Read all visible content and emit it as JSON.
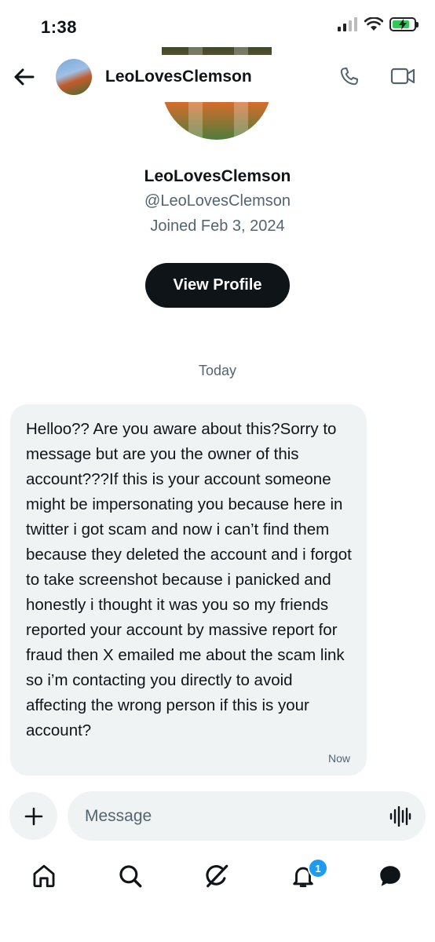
{
  "status_bar": {
    "time": "1:38",
    "battery_level": 0.8
  },
  "header": {
    "name": "LeoLovesClemson"
  },
  "profile": {
    "name": "LeoLovesClemson",
    "handle": "@LeoLovesClemson",
    "joined": "Joined Feb 3, 2024",
    "view_profile_label": "View Profile"
  },
  "conversation": {
    "date_separator": "Today",
    "messages": [
      {
        "text": "Helloo?? Are you aware about this?Sorry to message but are you the owner of this account???If this is your account someone might be impersonating you because here in twitter i got scam and now i can’t find them because they deleted the account and i forgot to take screenshot because i panicked and honestly i thought it was you so my friends reported your account by massive report for fraud then X emailed me about the scam link so i’m contacting you directly to avoid affecting the wrong person if this is your account?",
        "time": "Now"
      }
    ]
  },
  "composer": {
    "placeholder": "Message"
  },
  "tab_bar": {
    "items": [
      "home-icon",
      "search-icon",
      "grok-icon",
      "notifications-icon",
      "messages-icon"
    ],
    "notification_count": "1"
  },
  "colors": {
    "accent": "#1d9bf0",
    "bubble": "#eff3f4",
    "text": "#0f1419",
    "secondary": "#536471"
  }
}
